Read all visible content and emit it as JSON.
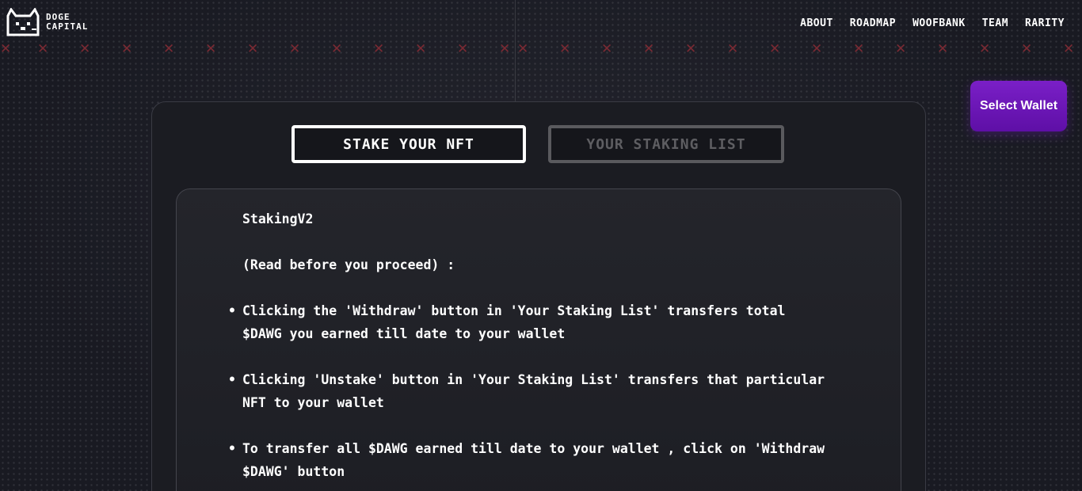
{
  "brand": {
    "line1": "DOGE",
    "line2": "CAPITAL",
    "icon": "doge-pixel-logo-icon"
  },
  "nav": {
    "items": [
      {
        "label": "ABOUT"
      },
      {
        "label": "ROADMAP"
      },
      {
        "label": "WOOFBANK"
      },
      {
        "label": "TEAM"
      },
      {
        "label": "RARITY"
      }
    ]
  },
  "decor": {
    "x_glyph": "✕"
  },
  "wallet": {
    "label": "Select Wallet"
  },
  "tabs": {
    "stake": {
      "label": "STAKE YOUR NFT"
    },
    "list": {
      "label": "YOUR STAKING LIST"
    }
  },
  "notice": {
    "title": "StakingV2",
    "subtitle": "(Read before you proceed) :",
    "bullets": [
      "Clicking the 'Withdraw' button in 'Your Staking List' transfers total $DAWG you earned till date to your wallet",
      "Clicking 'Unstake' button in 'Your Staking List' transfers that particular NFT to your wallet",
      "To transfer all $DAWG earned till date to your wallet , click on 'Withdraw $DAWG' button"
    ]
  },
  "colors": {
    "background": "#191a22",
    "accent_purple": "#6a16b8",
    "x_mark": "#7a2a33",
    "tab_inactive": "#5a5a5e"
  }
}
